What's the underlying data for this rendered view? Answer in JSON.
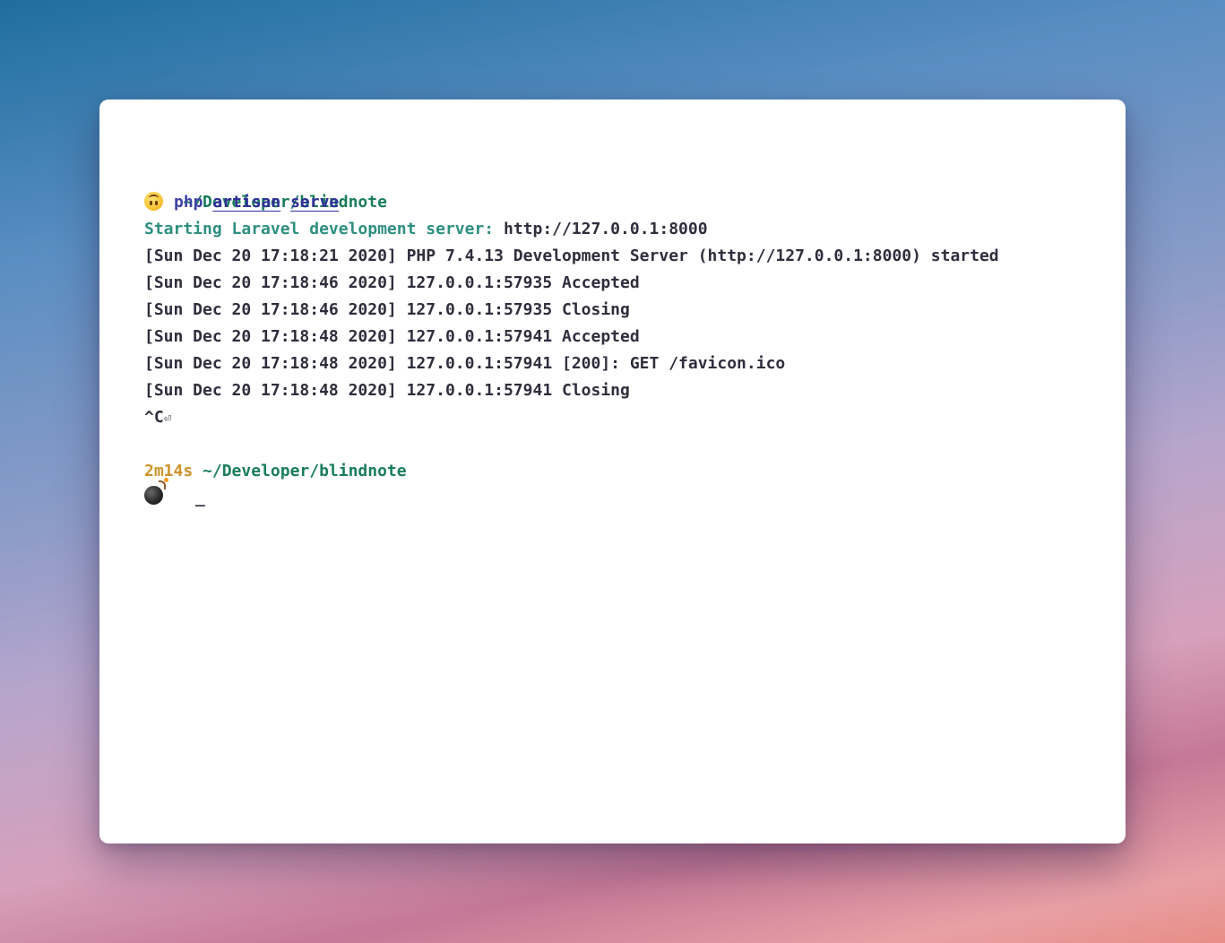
{
  "terminal": {
    "prompt1": {
      "path": "~/Developer/blindnote",
      "command": "php",
      "arg1": "artisan",
      "arg2": "serve"
    },
    "output": {
      "starting_label": "Starting Laravel development server:",
      "starting_url": " http://127.0.0.1:8000",
      "log_lines": [
        "[Sun Dec 20 17:18:21 2020] PHP 7.4.13 Development Server (http://127.0.0.1:8000) started",
        "[Sun Dec 20 17:18:46 2020] 127.0.0.1:57935 Accepted",
        "[Sun Dec 20 17:18:46 2020] 127.0.0.1:57935 Closing",
        "[Sun Dec 20 17:18:48 2020] 127.0.0.1:57941 Accepted",
        "[Sun Dec 20 17:18:48 2020] 127.0.0.1:57941 [200]: GET /favicon.ico",
        "[Sun Dec 20 17:18:48 2020] 127.0.0.1:57941 Closing"
      ],
      "interrupt": "^C",
      "return_symbol": "⏎"
    },
    "prompt2": {
      "duration": "2m14s",
      "path": "~/Developer/blindnote",
      "cursor": "_"
    },
    "icons": {
      "prompt1_emoji": "upside-down-face-icon",
      "prompt2_emoji": "bomb-icon"
    },
    "colors": {
      "path_green": "#1a7d5c",
      "starting_teal": "#2e8f80",
      "command_blue": "#3e40a8",
      "duration_orange": "#d0932a",
      "text_dark": "#2f2e3d"
    }
  }
}
